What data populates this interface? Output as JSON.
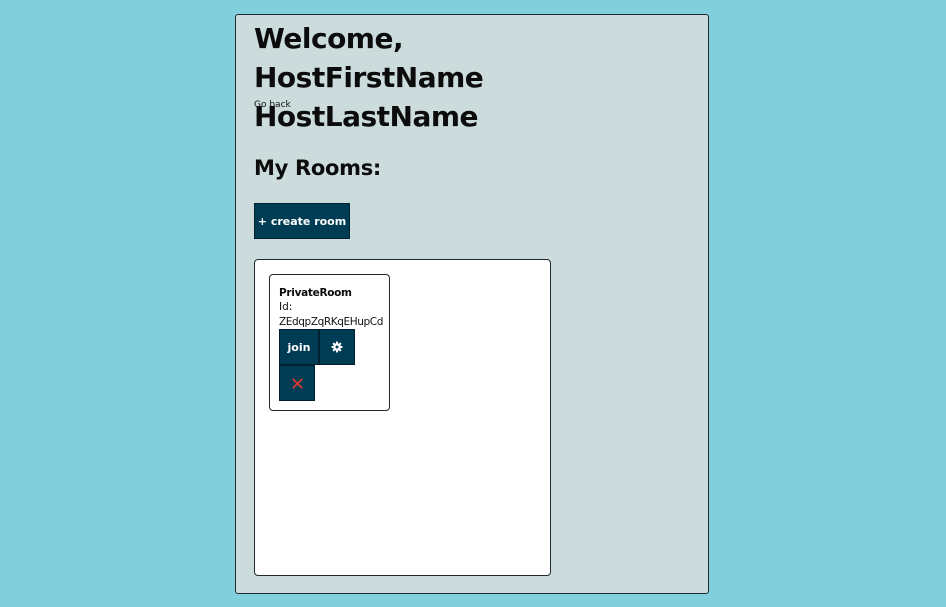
{
  "header": {
    "welcome": "Welcome, HostFirstName HostLastName",
    "go_back": "Go back"
  },
  "rooms": {
    "heading": "My Rooms:",
    "create_label": "+ create room",
    "items": [
      {
        "name": "PrivateRoom",
        "id_label": "Id:",
        "id_value": "ZEdqpZqRKqEHupCd",
        "join_label": "join",
        "settings_icon": "gear-icon",
        "delete_icon": "close-icon"
      }
    ]
  },
  "colors": {
    "page_background": "#80cfda",
    "panel_background": "#ccdcdc",
    "button_background": "#003c54",
    "delete_icon_color": "#e03a2a"
  }
}
